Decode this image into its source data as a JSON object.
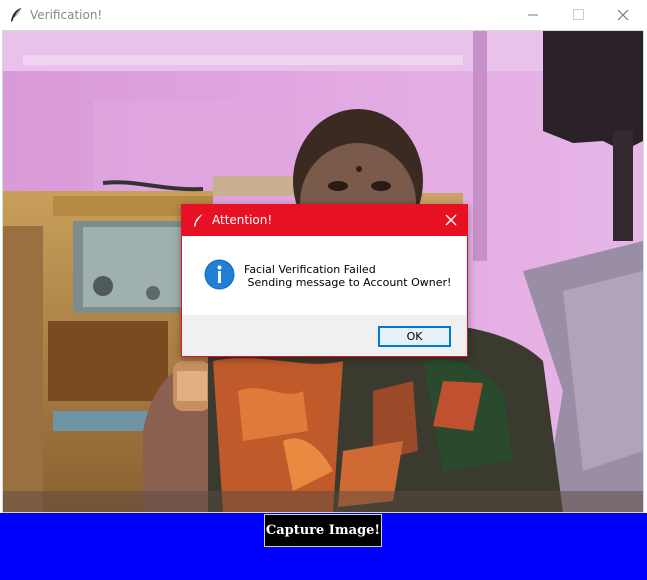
{
  "window": {
    "title": "Verification!",
    "icon": "tk-feather-icon",
    "controls": [
      "minimize-icon",
      "maximize-icon",
      "close-icon"
    ]
  },
  "camera": {
    "content": "live webcam frame"
  },
  "capture": {
    "label": "Capture Image!",
    "bar_color": "#0000ff"
  },
  "dialog": {
    "title": "Attention!",
    "title_color": "#e81123",
    "icon": "info-icon",
    "message": "Facial Verification Failed\n Sending message to Account Owner!",
    "ok_label": "OK"
  }
}
